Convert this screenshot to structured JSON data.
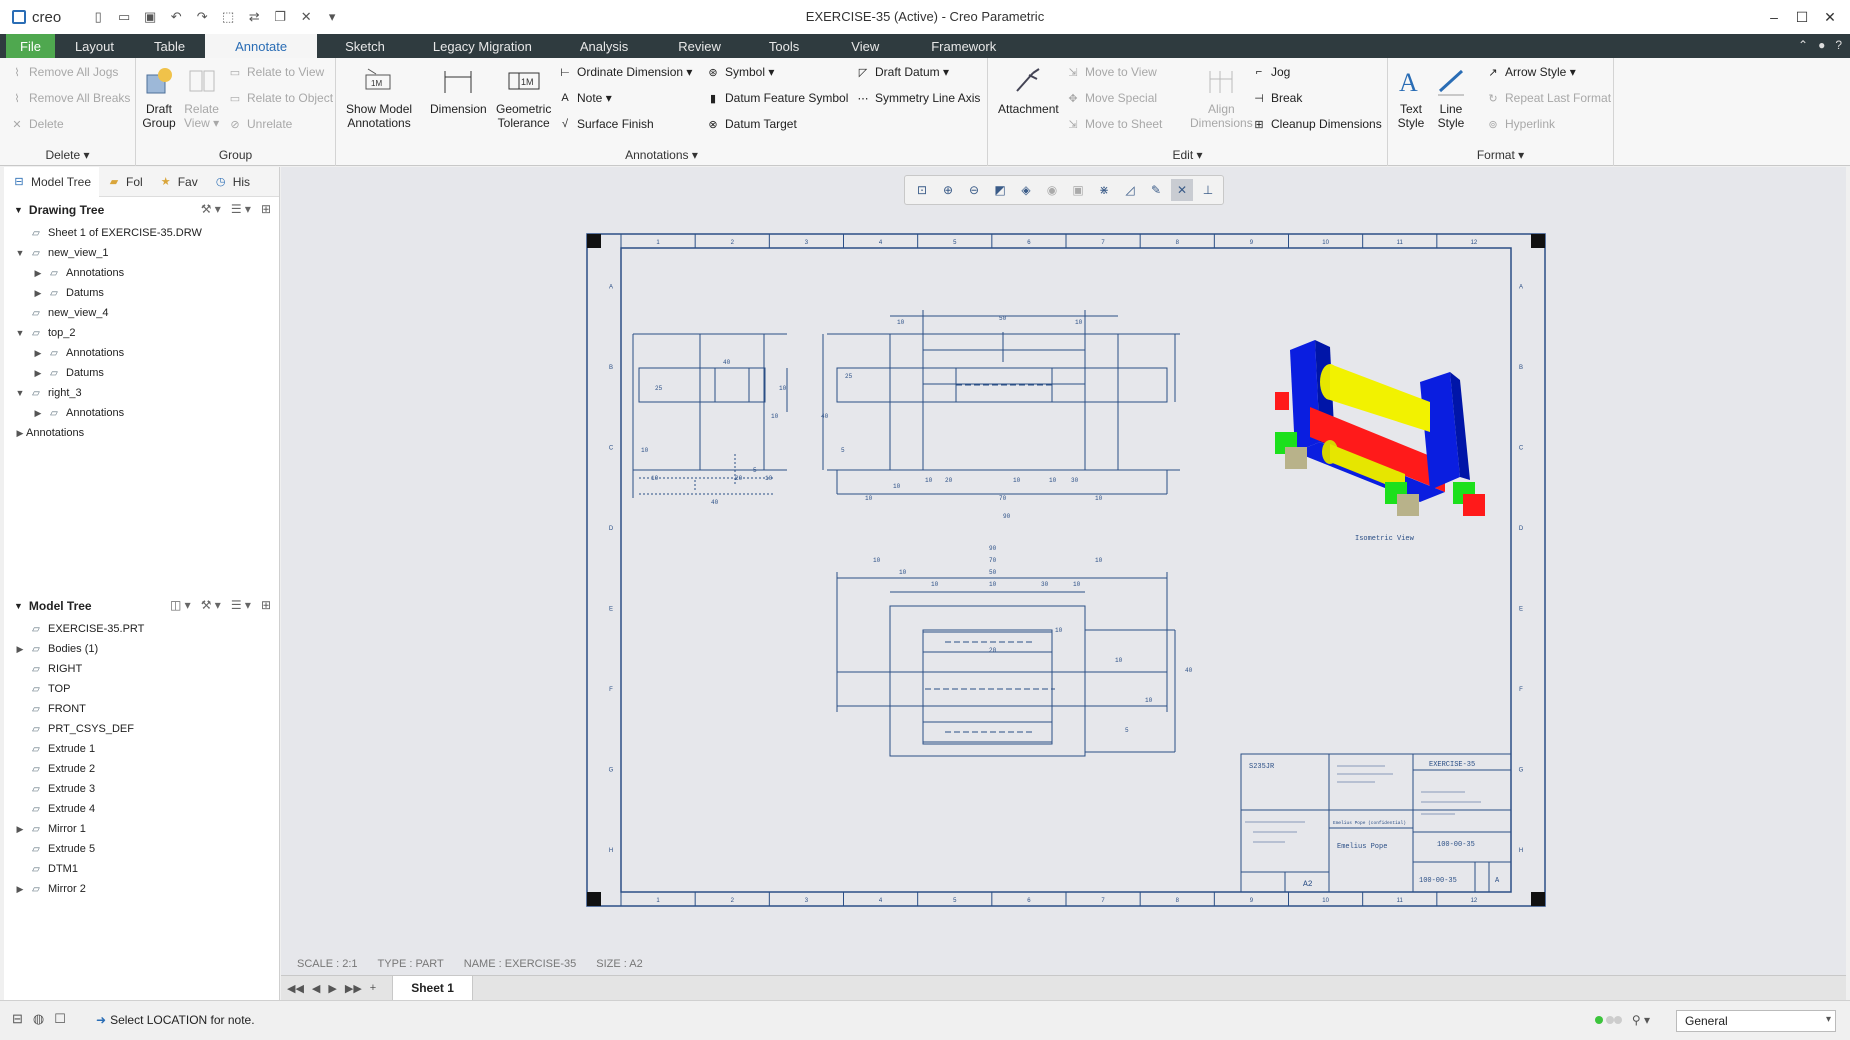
{
  "window": {
    "app_name": "creo",
    "title": "EXERCISE-35 (Active) - Creo Parametric"
  },
  "tabs": [
    "File",
    "Layout",
    "Table",
    "Annotate",
    "Sketch",
    "Legacy Migration",
    "Analysis",
    "Review",
    "Tools",
    "View",
    "Framework"
  ],
  "ribbon": {
    "delete_group": {
      "label": "Delete",
      "remove_all_jogs": "Remove All Jogs",
      "remove_all_breaks": "Remove All Breaks",
      "delete": "Delete"
    },
    "group_group": {
      "label": "Group",
      "draft_group_1": "Draft",
      "draft_group_2": "Group",
      "relate_view_1": "Relate",
      "relate_view_2": "View",
      "relate_to_view": "Relate to View",
      "relate_to_object": "Relate to Object",
      "unrelate": "Unrelate"
    },
    "annotations_group": {
      "label": "Annotations",
      "show_model_1": "Show Model",
      "show_model_2": "Annotations",
      "dimension": "Dimension",
      "geo_tol_1": "Geometric",
      "geo_tol_2": "Tolerance",
      "ordinate_dimension": "Ordinate Dimension",
      "note": "Note",
      "surface_finish": "Surface Finish",
      "symbol": "Symbol",
      "datum_feature_symbol": "Datum Feature Symbol",
      "datum_target": "Datum Target",
      "draft_datum": "Draft Datum",
      "symmetry_line_axis": "Symmetry Line Axis"
    },
    "edit_group": {
      "label": "Edit",
      "attachment": "Attachment",
      "move_to_view": "Move to View",
      "move_special": "Move Special",
      "move_to_sheet": "Move to Sheet",
      "align_1": "Align",
      "align_2": "Dimensions",
      "jog": "Jog",
      "break": "Break",
      "cleanup_dimensions": "Cleanup Dimensions"
    },
    "format_group": {
      "label": "Format",
      "text_style_1": "Text",
      "text_style_2": "Style",
      "line_style_1": "Line",
      "line_style_2": "Style",
      "arrow_style": "Arrow Style",
      "repeat_last_format": "Repeat Last Format",
      "hyperlink": "Hyperlink"
    }
  },
  "panel_tabs": [
    "Model Tree",
    "Fol",
    "Fav",
    "His"
  ],
  "drawing_tree": {
    "title": "Drawing Tree",
    "items": [
      {
        "label": "Sheet 1 of EXERCISE-35.DRW",
        "level": 0,
        "expander": ""
      },
      {
        "label": "new_view_1",
        "level": 0,
        "expander": "▼"
      },
      {
        "label": "Annotations",
        "level": 1,
        "expander": "▶"
      },
      {
        "label": "Datums",
        "level": 1,
        "expander": "▶"
      },
      {
        "label": "new_view_4",
        "level": 0,
        "expander": ""
      },
      {
        "label": "top_2",
        "level": 0,
        "expander": "▼"
      },
      {
        "label": "Annotations",
        "level": 1,
        "expander": "▶"
      },
      {
        "label": "Datums",
        "level": 1,
        "expander": "▶"
      },
      {
        "label": "right_3",
        "level": 0,
        "expander": "▼"
      },
      {
        "label": "Annotations",
        "level": 1,
        "expander": "▶"
      },
      {
        "label": "Annotations",
        "level": -1,
        "expander": "▶"
      }
    ]
  },
  "model_tree": {
    "title": "Model Tree",
    "items": [
      {
        "label": "EXERCISE-35.PRT",
        "expander": ""
      },
      {
        "label": "Bodies (1)",
        "expander": "▶"
      },
      {
        "label": "RIGHT",
        "expander": ""
      },
      {
        "label": "TOP",
        "expander": ""
      },
      {
        "label": "FRONT",
        "expander": ""
      },
      {
        "label": "PRT_CSYS_DEF",
        "expander": ""
      },
      {
        "label": "Extrude 1",
        "expander": ""
      },
      {
        "label": "Extrude 2",
        "expander": ""
      },
      {
        "label": "Extrude 3",
        "expander": ""
      },
      {
        "label": "Extrude 4",
        "expander": ""
      },
      {
        "label": "Mirror 1",
        "expander": "▶"
      },
      {
        "label": "Extrude 5",
        "expander": ""
      },
      {
        "label": "DTM1",
        "expander": ""
      },
      {
        "label": "Mirror 2",
        "expander": "▶"
      }
    ]
  },
  "drawing": {
    "isometric_label": "Isometric View",
    "dims_front": [
      "10",
      "50",
      "10",
      "40",
      "25",
      "5",
      "10",
      "20",
      "10",
      "10",
      "30",
      "10",
      "10",
      "70",
      "10",
      "90"
    ],
    "dims_left": [
      "10",
      "40",
      "25",
      "10",
      "10",
      "10",
      "20",
      "5",
      "10",
      "40"
    ],
    "dims_top": [
      "90",
      "10",
      "70",
      "10",
      "10",
      "50",
      "10",
      "10",
      "30",
      "10",
      "10",
      "10",
      "20",
      "5",
      "10",
      "40"
    ],
    "title_block": {
      "material": "S235JR",
      "part": "EXERCISE-35",
      "code1": "100-00-35",
      "code2": "100-00-35",
      "size": "A2",
      "rev": "A",
      "name": "Emelius Pope",
      "confidential": "Emelius Pope (confidential)"
    },
    "border_cols": [
      "1",
      "2",
      "3",
      "4",
      "5",
      "6",
      "7",
      "8",
      "9",
      "10",
      "11",
      "12"
    ],
    "border_rows": [
      "A",
      "B",
      "C",
      "D",
      "E",
      "F",
      "G",
      "H"
    ]
  },
  "sheet_info": {
    "scale": "SCALE : 2:1",
    "type": "TYPE : PART",
    "name": "NAME : EXERCISE-35",
    "size": "SIZE : A2"
  },
  "sheet_tab": "Sheet 1",
  "status": {
    "message": "Select LOCATION for note.",
    "filter": "General"
  },
  "colors": {
    "file_tab": "#4fa84f",
    "tab_bar": "#2f3b3f",
    "accent": "#2a6db5",
    "drawing_line": "#2b4f86"
  }
}
